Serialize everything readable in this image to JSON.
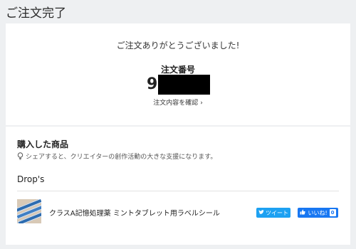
{
  "page": {
    "title": "ご注文完了"
  },
  "order": {
    "thanks_message": "ご注文ありがとうございました!",
    "number_label": "注文番号",
    "number_visible": "9",
    "confirm_link": "注文内容を確認",
    "confirm_chevron": "›"
  },
  "purchased": {
    "section_title": "購入した商品",
    "share_hint": "シェアすると、クリエイターの創作活動の大きな支援になります。",
    "hint_icon": "lightbulb-icon",
    "shop_name": "Drop's",
    "products": [
      {
        "name": "クラスA記憶処理薬 ミントタブレット用ラベルシール",
        "tweet_label": "ツイート",
        "like_label": "いいね!",
        "like_count": "0"
      }
    ]
  },
  "colors": {
    "background": "#eef0f2",
    "twitter_blue": "#1da1f2",
    "facebook_blue": "#1877f2"
  }
}
